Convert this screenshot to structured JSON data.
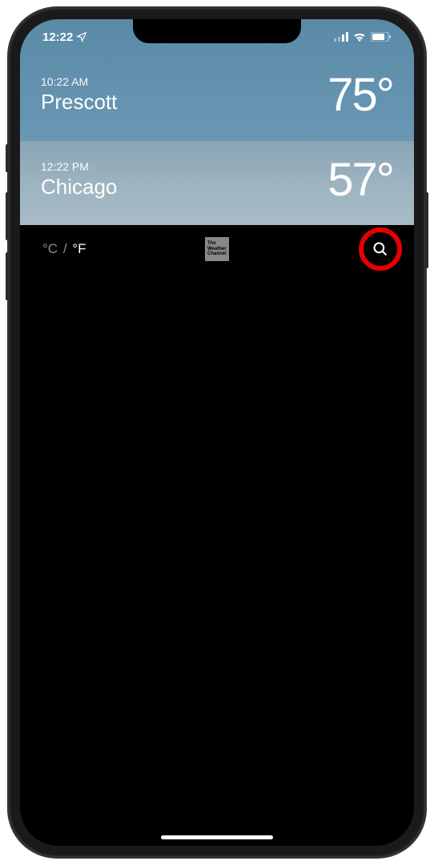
{
  "status_bar": {
    "time": "12:22"
  },
  "locations": [
    {
      "time": "10:22 AM",
      "name": "Prescott",
      "temp": "75°"
    },
    {
      "time": "12:22 PM",
      "name": "Chicago",
      "temp": "57°"
    }
  ],
  "footer": {
    "celsius_label": "°C",
    "divider": "/",
    "fahrenheit_label": "°F",
    "attribution": {
      "line1": "The",
      "line2": "Weather",
      "line3": "Channel"
    }
  }
}
